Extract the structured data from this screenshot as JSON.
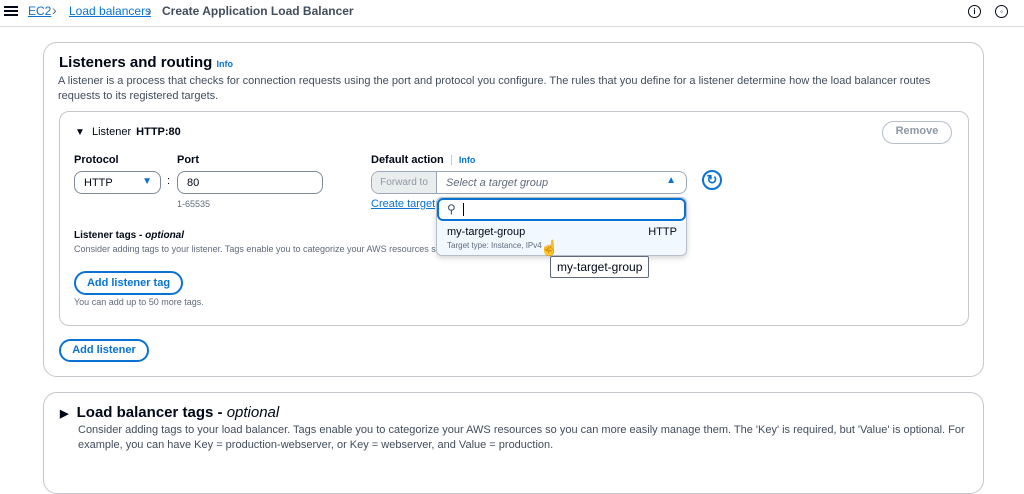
{
  "breadcrumb": {
    "items": [
      "EC2",
      "Load balancers",
      "Create Application Load Balancer"
    ]
  },
  "section": {
    "title": "Listeners and routing",
    "info": "Info",
    "description": "A listener is a process that checks for connection requests using the port and protocol you configure. The rules that you define for a listener determine how the load balancer routes requests to its registered targets."
  },
  "listener": {
    "header_label": "Listener",
    "header_value": "HTTP:80",
    "remove_label": "Remove",
    "protocol_label": "Protocol",
    "protocol_value": "HTTP",
    "port_label": "Port",
    "port_value": "80",
    "port_hint": "1-65535",
    "separator": ":",
    "default_action_label": "Default action",
    "default_action_info": "Info",
    "forward_to_label": "Forward to",
    "target_group_placeholder": "Select a target group",
    "create_target_group_link": "Create target group",
    "tags_title": "Listener tags -",
    "tags_title_optional": "optional",
    "tags_description": "Consider adding tags to your listener. Tags enable you to categorize your AWS resources so you can more easily manage them.",
    "add_tag_label": "Add listener tag",
    "tags_limit": "You can add up to 50 more tags."
  },
  "dropdown": {
    "search_value": "",
    "options": [
      {
        "name": "my-target-group",
        "protocol": "HTTP",
        "detail": "Target type: Instance, IPv4"
      }
    ]
  },
  "tooltip": "my-target-group",
  "add_listener_label": "Add listener",
  "lb_tags": {
    "title": "Load balancer tags -",
    "title_optional": "optional",
    "description": "Consider adding tags to your load balancer. Tags enable you to categorize your AWS resources so you can more easily manage them. The 'Key' is required, but 'Value' is optional. For example, you can have Key = production-webserver, or Key = webserver, and Value = production."
  },
  "colors": {
    "link": "#0972d3",
    "border": "#c6c6cd",
    "text": "#000716"
  }
}
